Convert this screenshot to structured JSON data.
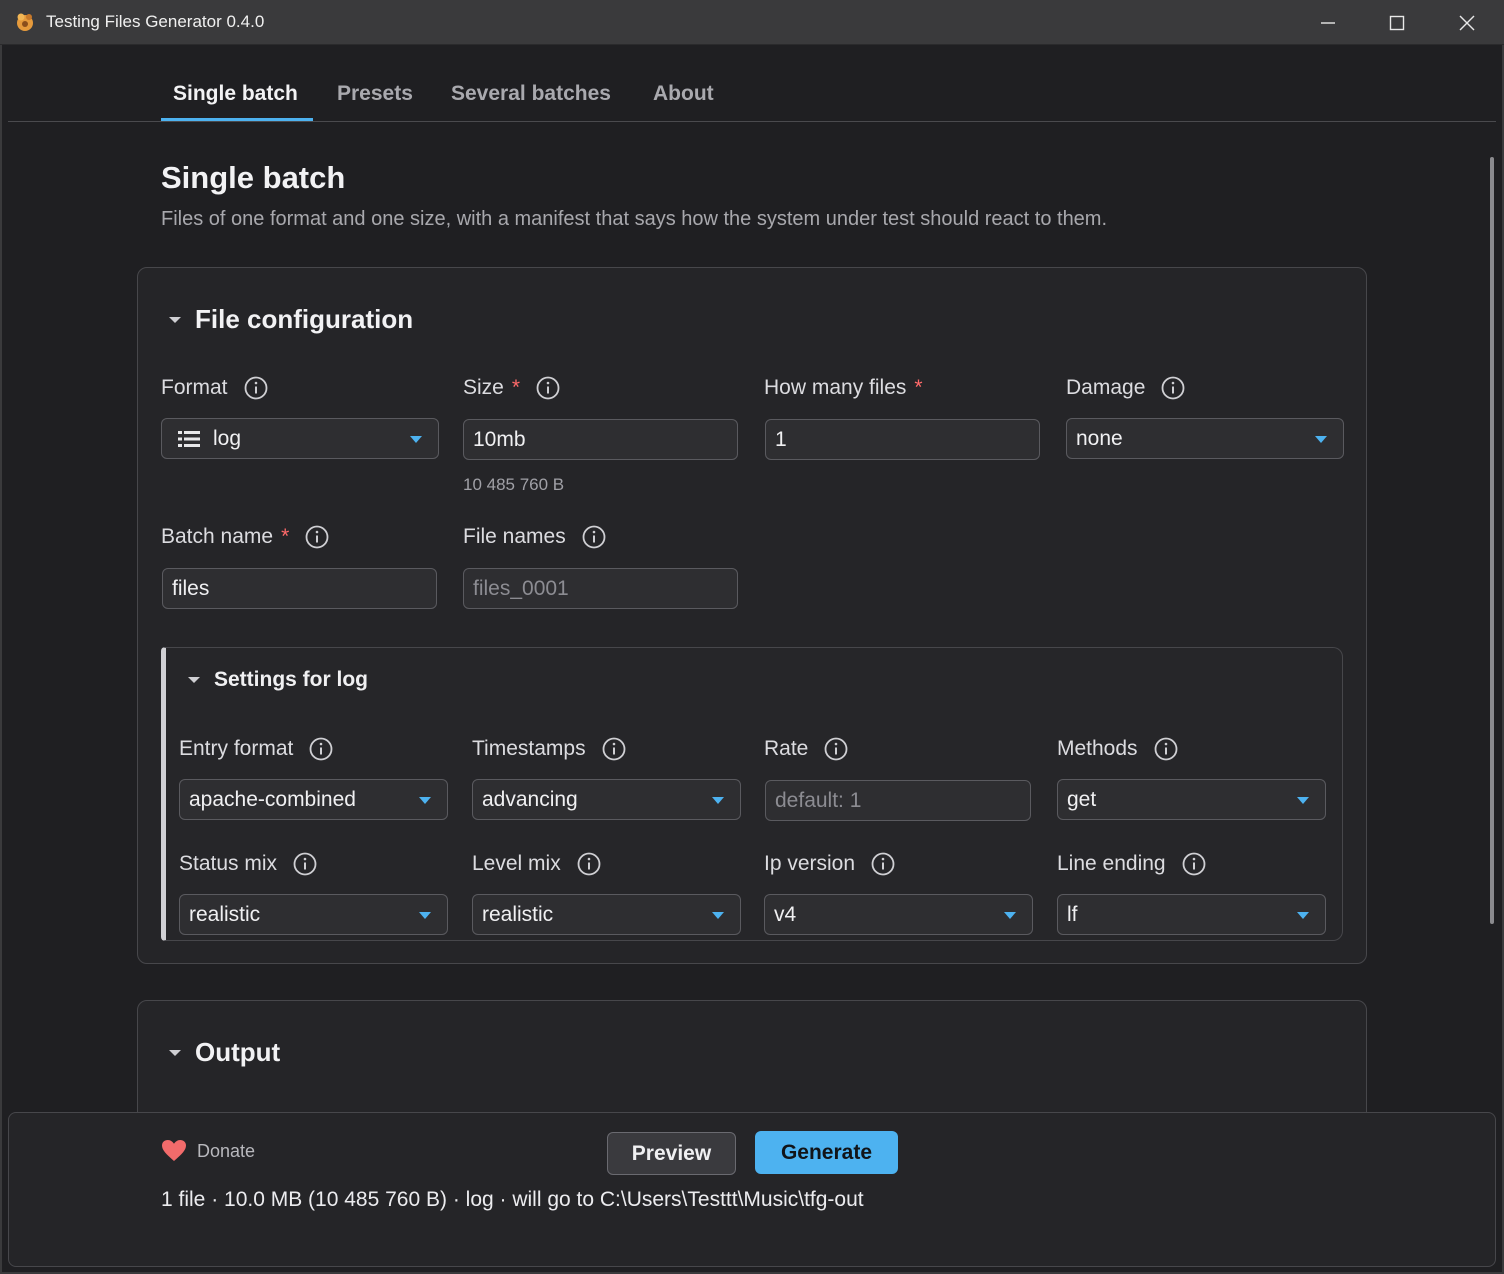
{
  "window": {
    "title": "Testing Files Generator 0.4.0"
  },
  "tabs": [
    {
      "label": "Single batch"
    },
    {
      "label": "Presets"
    },
    {
      "label": "Several batches"
    },
    {
      "label": "About"
    }
  ],
  "page": {
    "title": "Single batch",
    "subtitle": "Files of one format and one size, with a manifest that says how the system under test should react to them."
  },
  "file_config": {
    "title": "File configuration",
    "format": {
      "label": "Format",
      "value": "log"
    },
    "size": {
      "label": "Size",
      "required": "*",
      "value": "10mb",
      "hint": "10 485 760 B"
    },
    "count": {
      "label": "How many files",
      "required": "*",
      "value": "1"
    },
    "damage": {
      "label": "Damage",
      "value": "none"
    },
    "batch_name": {
      "label": "Batch name",
      "required": "*",
      "value": "files"
    },
    "file_names": {
      "label": "File names",
      "placeholder": "files_0001"
    }
  },
  "log_settings": {
    "title": "Settings for log",
    "entry_format": {
      "label": "Entry format",
      "value": "apache-combined"
    },
    "timestamps": {
      "label": "Timestamps",
      "value": "advancing"
    },
    "rate": {
      "label": "Rate",
      "placeholder": "default: 1"
    },
    "methods": {
      "label": "Methods",
      "value": "get"
    },
    "status_mix": {
      "label": "Status mix",
      "value": "realistic"
    },
    "level_mix": {
      "label": "Level mix",
      "value": "realistic"
    },
    "ip_version": {
      "label": "Ip version",
      "value": "v4"
    },
    "line_ending": {
      "label": "Line ending",
      "value": "lf"
    }
  },
  "output": {
    "title": "Output"
  },
  "footer": {
    "donate": "Donate",
    "preview": "Preview",
    "generate": "Generate",
    "summary": "1 file · 10.0 MB (10 485 760 B) · log · will go to C:\\Users\\Testtt\\Music\\tfg-out"
  },
  "colors": {
    "accent": "#4db2f0",
    "required": "#ff6a6a",
    "heart": "#f26b6b"
  }
}
